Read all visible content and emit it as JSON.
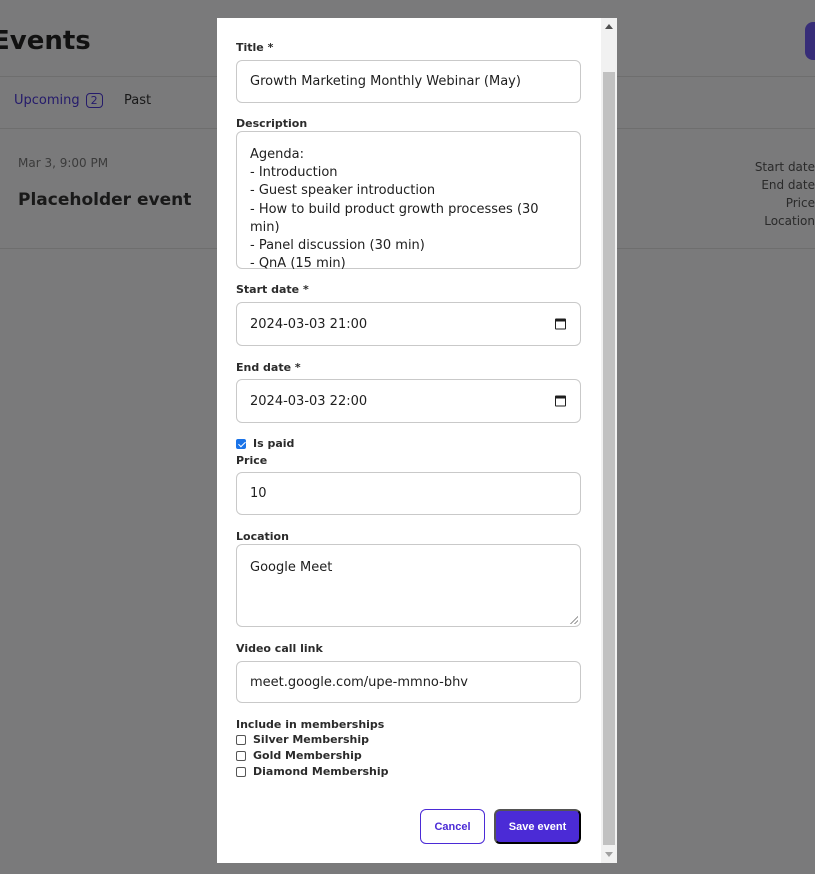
{
  "background": {
    "page_title": "Events",
    "tabs": [
      {
        "label": "Upcoming",
        "count": "2"
      },
      {
        "label": "Past",
        "count": ""
      }
    ],
    "event_date": "Mar 3, 9:00 PM",
    "event_title": "Placeholder event",
    "right_info": [
      "Start date",
      "End date",
      "Price",
      "Location"
    ]
  },
  "form": {
    "title": {
      "label": "Title *",
      "value": "Growth Marketing Monthly Webinar (May)"
    },
    "description": {
      "label": "Description",
      "value": "Agenda:\n- Introduction\n- Guest speaker introduction\n- How to build product growth processes (30 min)\n- Panel discussion (30 min)\n- QnA (15 min)"
    },
    "start_date": {
      "label": "Start date *",
      "value": "2024-03-03 21:00"
    },
    "end_date": {
      "label": "End date *",
      "value": "2024-03-03 22:00"
    },
    "is_paid": {
      "label": "Is paid",
      "checked": true
    },
    "price": {
      "label": "Price",
      "value": "10"
    },
    "location": {
      "label": "Location",
      "value": "Google Meet"
    },
    "video_call_link": {
      "label": "Video call link",
      "value": "meet.google.com/upe-mmno-bhv"
    },
    "memberships": {
      "label": "Include in memberships",
      "options": [
        {
          "label": "Silver Membership",
          "checked": false
        },
        {
          "label": "Gold Membership",
          "checked": false
        },
        {
          "label": "Diamond Membership",
          "checked": false
        }
      ]
    },
    "buttons": {
      "cancel": "Cancel",
      "save": "Save event"
    }
  },
  "colors": {
    "accent": "#4b2bd6",
    "checkbox": "#1a73e8"
  },
  "icons": [
    "calendar-icon",
    "scroll-up-arrow-icon",
    "scroll-down-arrow-icon"
  ]
}
